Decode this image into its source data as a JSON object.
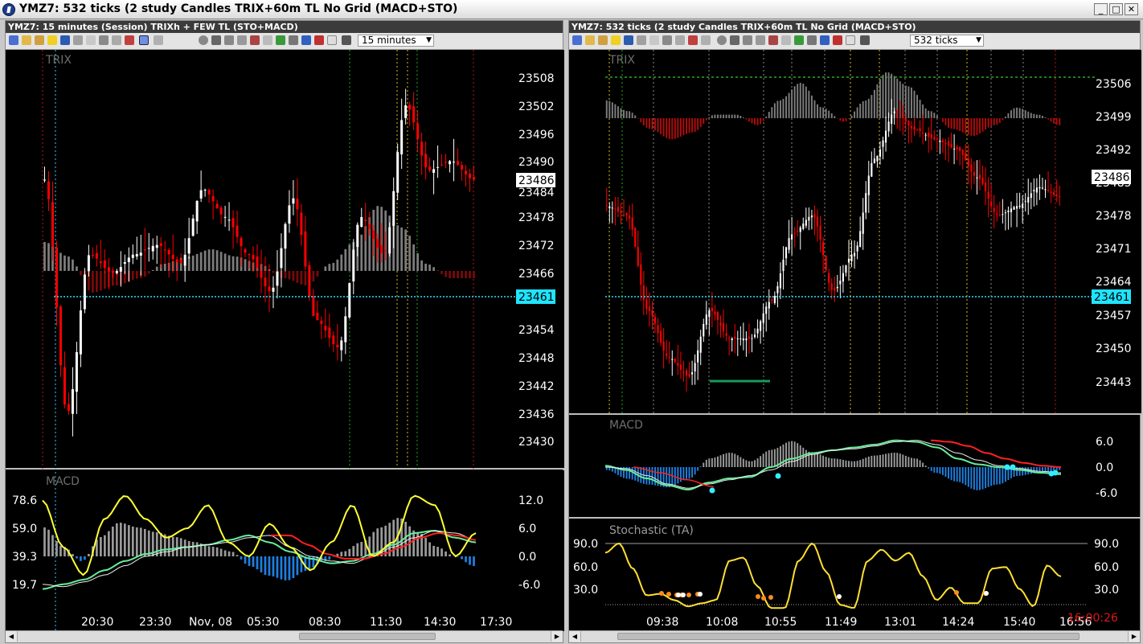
{
  "window": {
    "title": "YMZ7: 532 ticks (2 study Candles TRIX+60m TL No Grid (MACD+STO)",
    "minimize": "_",
    "maximize": "□",
    "close": "✕"
  },
  "left": {
    "header": "YMZ7: 15 minutes (Session)        TRIXh + FEW TL  (STO+MACD)",
    "timeframe": "15 minutes",
    "price_panel_label": "TRIX",
    "macd_label": "MACD",
    "price_axis": [
      "23508",
      "23502",
      "23496",
      "23490",
      "23484",
      "23478",
      "23472",
      "23466",
      "23454",
      "23448",
      "23442",
      "23436",
      "23430"
    ],
    "last_price": "23486",
    "marker_price": "23461",
    "macd_left_axis": [
      "78.6",
      "59.0",
      "39.3",
      "19.7"
    ],
    "macd_right_axis": [
      "12.0",
      "6.0",
      "0.0",
      "-6.0"
    ],
    "time_axis": [
      "20:30",
      "23:30",
      "Nov, 08",
      "05:30",
      "08:30",
      "11:30",
      "14:30",
      "17:30"
    ]
  },
  "right": {
    "header": "YMZ7: 532 ticks (2 study Candles TRIX+60m TL No Grid (MACD+STO)",
    "timeframe": "532 ticks",
    "price_panel_label": "TRIX",
    "macd_label": "MACD",
    "stoch_label": "Stochastic (TA)",
    "price_axis": [
      "23506",
      "23499",
      "23492",
      "23485",
      "23478",
      "23471",
      "23464",
      "23457",
      "23450",
      "23443"
    ],
    "last_price": "23486",
    "marker_price": "23461",
    "macd_axis": [
      "6.0",
      "0.0",
      "-6.0"
    ],
    "stoch_left_axis": [
      "90.0",
      "60.0",
      "30.0"
    ],
    "stoch_right_axis": [
      "90.0",
      "60.0",
      "30.0"
    ],
    "time_axis": [
      "09:38",
      "10:08",
      "10:55",
      "11:49",
      "13:01",
      "14:24",
      "15:40",
      "16:56"
    ],
    "clock": "16:00:26"
  },
  "colors": {
    "up_candle": "#ffffff",
    "down_candle": "#ff0000",
    "macd_up": "#9a9a9a",
    "macd_down": "#1e7fe0",
    "signal_line": "#ffff33",
    "marker_line": "#33ddff",
    "stoch": "#ffe033"
  }
}
